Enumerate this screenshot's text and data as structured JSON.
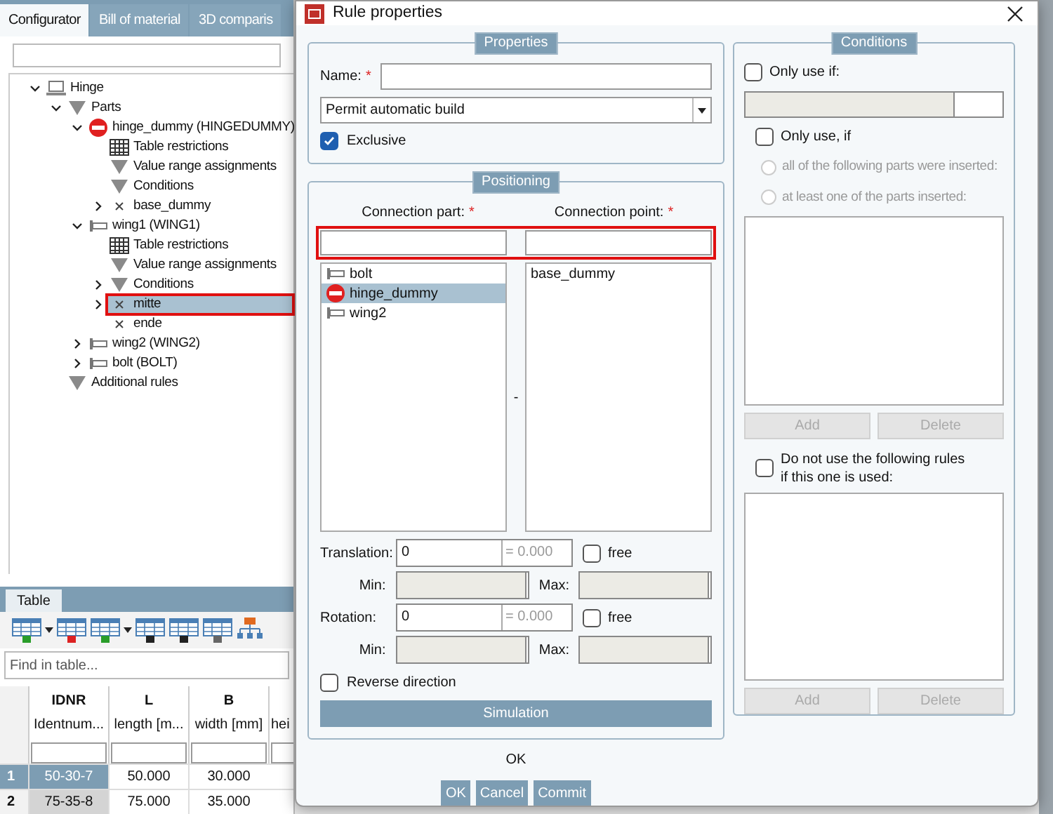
{
  "main_tabs": [
    {
      "label": "Configurator",
      "selected": true
    },
    {
      "label": "Bill of material",
      "selected": false
    },
    {
      "label": "3D comparis",
      "selected": false
    }
  ],
  "tree": [
    {
      "label": "Hinge",
      "kind": "assembly",
      "expanded": true,
      "selected": false,
      "children": [
        {
          "label": "Parts",
          "kind": "group",
          "expanded": true,
          "selected": false,
          "children": [
            {
              "label": "hinge_dummy (HINGEDUMMY)",
              "kind": "blocked-part",
              "expanded": true,
              "selected": false,
              "children": [
                {
                  "label": "Table restrictions",
                  "kind": "table",
                  "selected": false
                },
                {
                  "label": "Value range assignments",
                  "kind": "group",
                  "selected": false
                },
                {
                  "label": "Conditions",
                  "kind": "group",
                  "selected": false
                },
                {
                  "label": "base_dummy",
                  "kind": "point",
                  "expanded": false,
                  "selected": false
                }
              ]
            },
            {
              "label": "wing1 (WING1)",
              "kind": "part",
              "expanded": true,
              "selected": false,
              "children": [
                {
                  "label": "Table restrictions",
                  "kind": "table",
                  "selected": false
                },
                {
                  "label": "Value range assignments",
                  "kind": "group",
                  "selected": false
                },
                {
                  "label": "Conditions",
                  "kind": "group",
                  "expanded": false,
                  "selected": false
                },
                {
                  "label": "mitte",
                  "kind": "point",
                  "expanded": false,
                  "selected": true
                },
                {
                  "label": "ende",
                  "kind": "point",
                  "selected": false
                }
              ]
            },
            {
              "label": "wing2 (WING2)",
              "kind": "part",
              "expanded": false,
              "selected": false
            },
            {
              "label": "bolt (BOLT)",
              "kind": "part",
              "expanded": false,
              "selected": false
            }
          ]
        },
        {
          "label": "Additional rules",
          "kind": "group",
          "selected": false
        }
      ]
    }
  ],
  "table_panel": {
    "tab": "Table",
    "search_placeholder": "Find in table...",
    "columns": [
      {
        "name": "IDNR",
        "description": "Identnum..."
      },
      {
        "name": "L",
        "description": "length [m..."
      },
      {
        "name": "B",
        "description": "width [mm]"
      },
      {
        "description": "hei"
      }
    ],
    "rows": [
      {
        "number": "1",
        "selected": true,
        "cells": [
          "50-30-7",
          "50.000",
          "30.000"
        ]
      },
      {
        "number": "2",
        "selected": false,
        "cells": [
          "75-35-8",
          "75.000",
          "35.000"
        ]
      }
    ]
  },
  "dialog": {
    "title": "Rule properties",
    "properties": {
      "title": "Properties",
      "name_label": "Name:",
      "required_mark": "*",
      "build_mode": "Permit automatic build",
      "exclusive": {
        "label": "Exclusive",
        "checked": true
      }
    },
    "positioning": {
      "title": "Positioning",
      "part_label": "Connection part:",
      "part_required_mark": "*",
      "point_label": "Connection point:",
      "point_required_mark": "*",
      "parts": [
        {
          "label": "bolt",
          "kind": "part",
          "selected": false
        },
        {
          "label": "hinge_dummy",
          "kind": "blocked-part",
          "selected": true
        },
        {
          "label": "wing2",
          "kind": "part",
          "selected": false
        }
      ],
      "separator": "-",
      "points": [
        {
          "label": "base_dummy",
          "selected": false
        }
      ],
      "translation": {
        "label": "Translation:",
        "value": "0",
        "result": "= 0.000",
        "free_label": "free",
        "free": false,
        "min_label": "Min:",
        "max_label": "Max:"
      },
      "rotation": {
        "label": "Rotation:",
        "value": "0",
        "result": "= 0.000",
        "free_label": "free",
        "free": false,
        "min_label": "Min:",
        "max_label": "Max:"
      },
      "reverse": {
        "label": "Reverse direction",
        "checked": false
      },
      "simulation": "Simulation"
    },
    "conditions": {
      "title": "Conditions",
      "only_use_if": {
        "label": "Only use if:",
        "checked": false
      },
      "only_use_parts": {
        "label": "Only use, if",
        "checked": false
      },
      "options": [
        {
          "label": "all of the following parts were inserted:",
          "selected": false
        },
        {
          "label": "at least one of the parts inserted:",
          "selected": false
        }
      ],
      "add": "Add",
      "delete": "Delete",
      "exclude": {
        "label": "Do not use the following rules",
        "label_line2": "if this one is used:",
        "checked": false
      },
      "add2": "Add",
      "delete2": "Delete"
    },
    "status": "OK",
    "buttons": [
      "OK",
      "Cancel",
      "Commit"
    ]
  }
}
